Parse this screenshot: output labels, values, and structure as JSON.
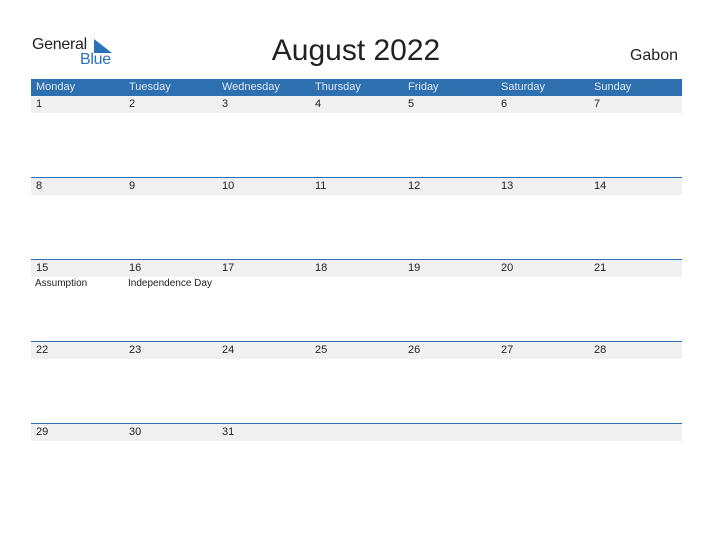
{
  "logo": {
    "general": "General",
    "blue": "Blue"
  },
  "title": "August 2022",
  "country": "Gabon",
  "colors": {
    "accent": "#2e6fb0",
    "date_strip": "#f0f0f0"
  },
  "weekdays": [
    "Monday",
    "Tuesday",
    "Wednesday",
    "Thursday",
    "Friday",
    "Saturday",
    "Sunday"
  ],
  "weeks": [
    {
      "days": [
        {
          "num": "1",
          "event": ""
        },
        {
          "num": "2",
          "event": ""
        },
        {
          "num": "3",
          "event": ""
        },
        {
          "num": "4",
          "event": ""
        },
        {
          "num": "5",
          "event": ""
        },
        {
          "num": "6",
          "event": ""
        },
        {
          "num": "7",
          "event": ""
        }
      ]
    },
    {
      "days": [
        {
          "num": "8",
          "event": ""
        },
        {
          "num": "9",
          "event": ""
        },
        {
          "num": "10",
          "event": ""
        },
        {
          "num": "11",
          "event": ""
        },
        {
          "num": "12",
          "event": ""
        },
        {
          "num": "13",
          "event": ""
        },
        {
          "num": "14",
          "event": ""
        }
      ]
    },
    {
      "days": [
        {
          "num": "15",
          "event": "Assumption"
        },
        {
          "num": "16",
          "event": "Independence Day"
        },
        {
          "num": "17",
          "event": ""
        },
        {
          "num": "18",
          "event": ""
        },
        {
          "num": "19",
          "event": ""
        },
        {
          "num": "20",
          "event": ""
        },
        {
          "num": "21",
          "event": ""
        }
      ]
    },
    {
      "days": [
        {
          "num": "22",
          "event": ""
        },
        {
          "num": "23",
          "event": ""
        },
        {
          "num": "24",
          "event": ""
        },
        {
          "num": "25",
          "event": ""
        },
        {
          "num": "26",
          "event": ""
        },
        {
          "num": "27",
          "event": ""
        },
        {
          "num": "28",
          "event": ""
        }
      ]
    },
    {
      "days": [
        {
          "num": "29",
          "event": ""
        },
        {
          "num": "30",
          "event": ""
        },
        {
          "num": "31",
          "event": ""
        },
        {
          "num": "",
          "event": ""
        },
        {
          "num": "",
          "event": ""
        },
        {
          "num": "",
          "event": ""
        },
        {
          "num": "",
          "event": ""
        }
      ]
    }
  ]
}
